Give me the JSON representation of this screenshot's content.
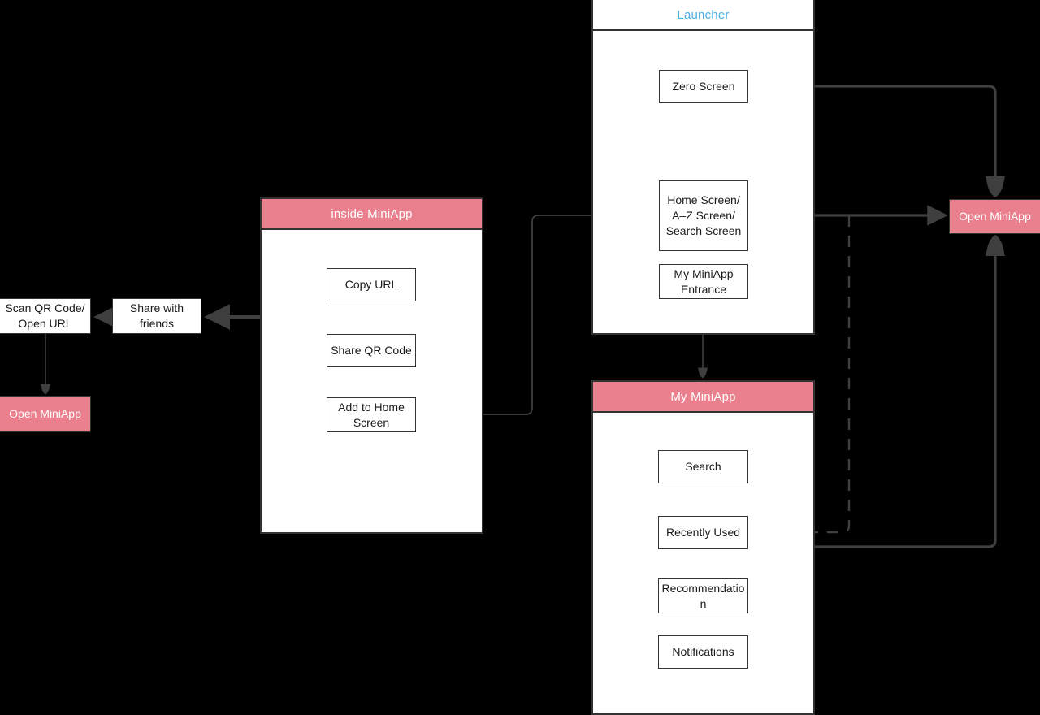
{
  "diagram": {
    "type": "flowchart",
    "background": "#000000",
    "colors": {
      "accent_pink": "#ea808d",
      "accent_blue": "#4ab0e6",
      "node_stroke": "#333333",
      "node_fill": "#ffffff",
      "wire": "#3f3f3f"
    }
  },
  "panels": {
    "launcher": {
      "title": "Launcher",
      "title_style": "plain-blue",
      "nodes": [
        {
          "id": "zero-screen",
          "label": "Zero Screen"
        },
        {
          "id": "home-az-search-screen",
          "label": "Home Screen/\nA–Z Screen/\nSearch Screen"
        },
        {
          "id": "my-miniapp-entrance",
          "label": "My MiniApp\nEntrance"
        }
      ]
    },
    "inside_miniapp": {
      "title": "inside MiniApp",
      "title_style": "pink",
      "nodes": [
        {
          "id": "copy-url",
          "label": "Copy URL"
        },
        {
          "id": "share-qr-code",
          "label": "Share QR Code"
        },
        {
          "id": "add-to-home-screen",
          "label": "Add to Home\nScreen"
        }
      ]
    },
    "my_miniapp": {
      "title": "My MiniApp",
      "title_style": "pink",
      "nodes": [
        {
          "id": "search",
          "label": "Search"
        },
        {
          "id": "recently-used",
          "label": "Recently Used"
        },
        {
          "id": "recommendation",
          "label": "Recommendatio\nn"
        },
        {
          "id": "notifications",
          "label": "Notifications"
        }
      ]
    }
  },
  "loose_nodes": [
    {
      "id": "scan-qr-open-url",
      "label": "Scan QR Code/\nOpen URL",
      "style": "white"
    },
    {
      "id": "share-with-friends",
      "label": "Share with\nfriends",
      "style": "white"
    },
    {
      "id": "open-miniapp-left",
      "label": "Open MiniApp",
      "style": "pink"
    },
    {
      "id": "open-miniapp-right",
      "label": "Open MiniApp",
      "style": "pink"
    }
  ],
  "edges": [
    {
      "from": "copy-url",
      "to": "share-with-friends",
      "style": "solid"
    },
    {
      "from": "share-qr-code",
      "to": "share-with-friends",
      "style": "solid"
    },
    {
      "from": "share-with-friends",
      "to": "scan-qr-open-url",
      "style": "solid"
    },
    {
      "from": "scan-qr-open-url",
      "to": "open-miniapp-left",
      "style": "solid"
    },
    {
      "from": "add-to-home-screen",
      "to": "home-az-search-screen",
      "style": "solid"
    },
    {
      "from": "zero-screen",
      "to": "open-miniapp-right",
      "style": "solid"
    },
    {
      "from": "home-az-search-screen",
      "to": "open-miniapp-right",
      "style": "solid"
    },
    {
      "from": "open-miniapp-right",
      "to": "recently-used",
      "style": "dashed"
    },
    {
      "from": "my-miniapp-entrance",
      "to": "my_miniapp",
      "style": "solid"
    }
  ]
}
